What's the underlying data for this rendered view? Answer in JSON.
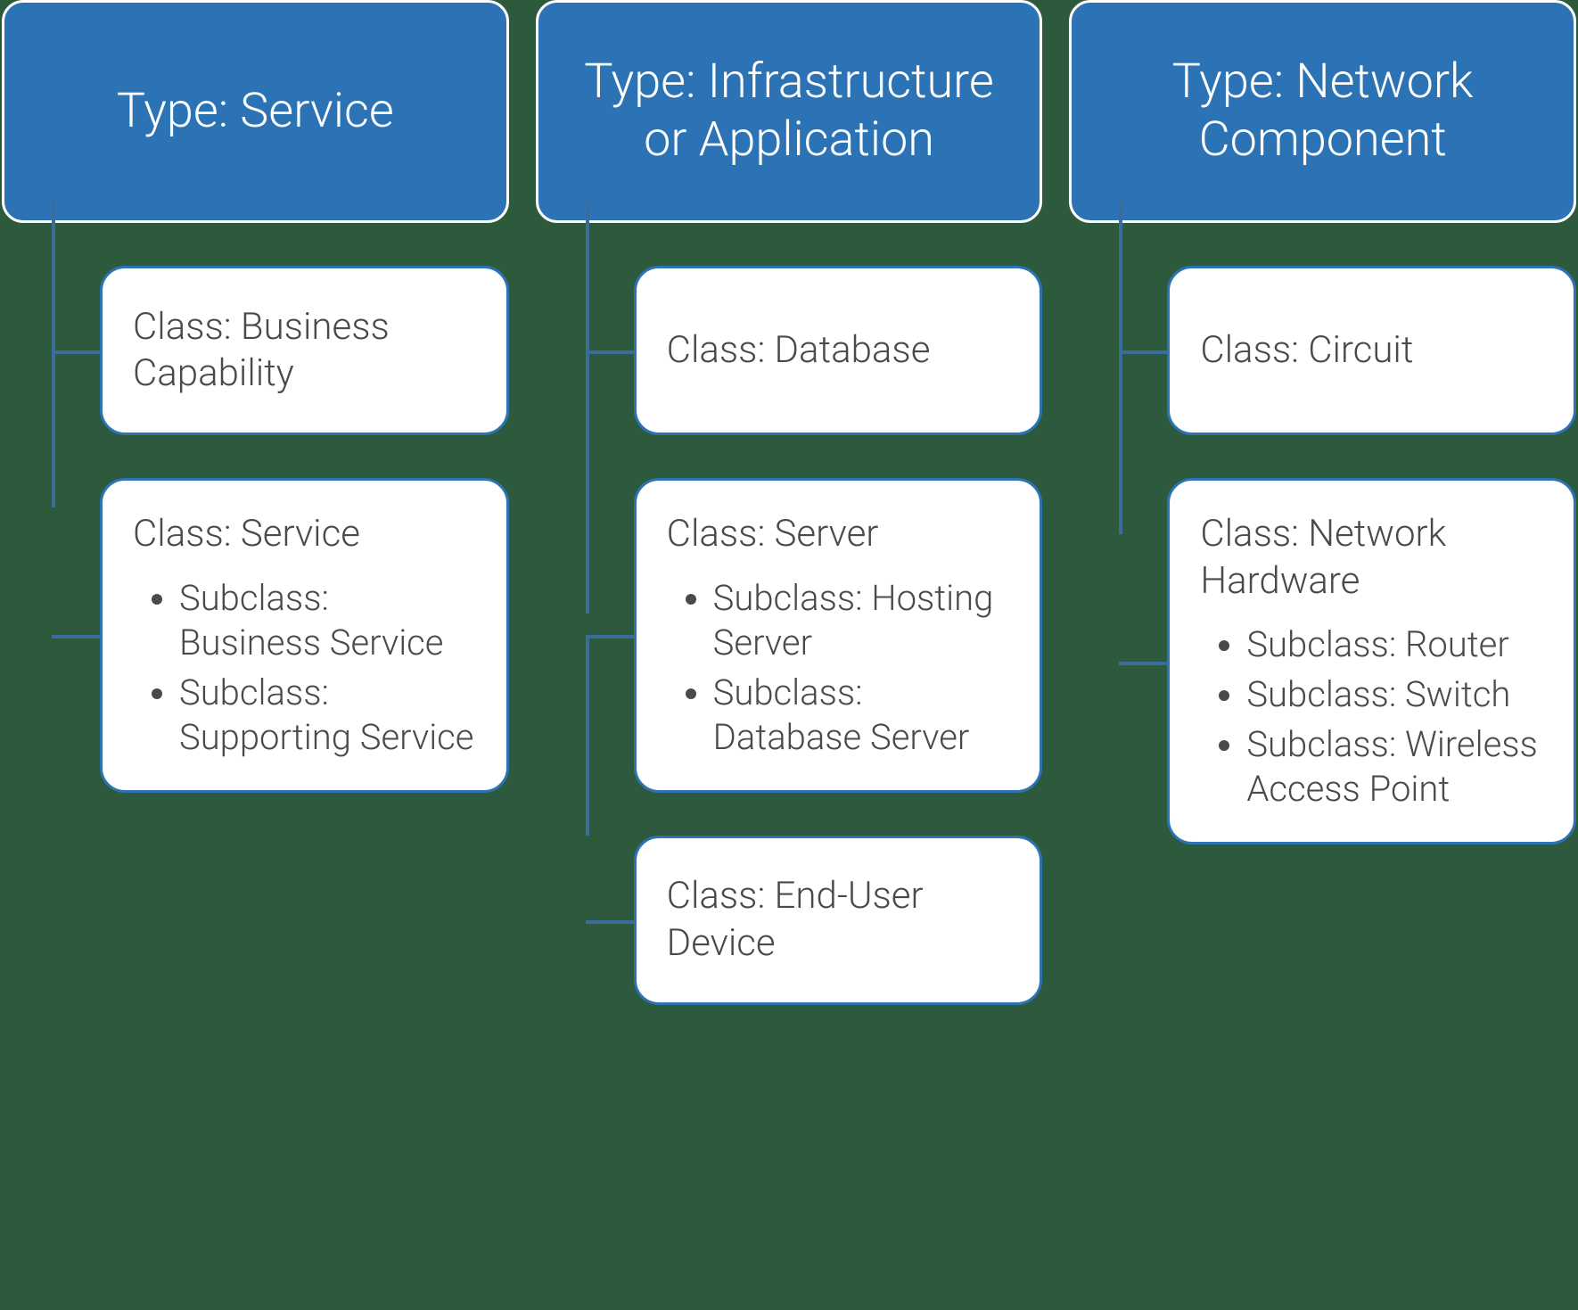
{
  "colors": {
    "type_bg": "#2b73b4",
    "type_border": "#ffffff",
    "class_bg": "#ffffff",
    "class_border": "#2b73b4",
    "connector": "#3a6d99",
    "page_bg": "#2d5a3d",
    "text_light": "#ffffff",
    "text_dark": "#4a4a4a"
  },
  "columns": [
    {
      "type_label": "Type: Service",
      "classes": [
        {
          "label": "Class: Business Capability",
          "subclasses": []
        },
        {
          "label": "Class: Service",
          "subclasses": [
            "Subclass: Business Service",
            "Subclass: Supporting Service"
          ]
        }
      ]
    },
    {
      "type_label": "Type: Infrastructure or Application",
      "classes": [
        {
          "label": "Class: Database",
          "subclasses": []
        },
        {
          "label": "Class: Server",
          "subclasses": [
            "Subclass: Hosting Server",
            "Subclass: Database Server"
          ]
        },
        {
          "label": "Class: End-User Device",
          "subclasses": []
        }
      ]
    },
    {
      "type_label": "Type: Network Component",
      "classes": [
        {
          "label": "Class: Circuit",
          "subclasses": []
        },
        {
          "label": "Class: Network Hardware",
          "subclasses": [
            "Subclass: Router",
            "Subclass: Switch",
            "Subclass: Wireless Access Point"
          ]
        }
      ]
    }
  ]
}
